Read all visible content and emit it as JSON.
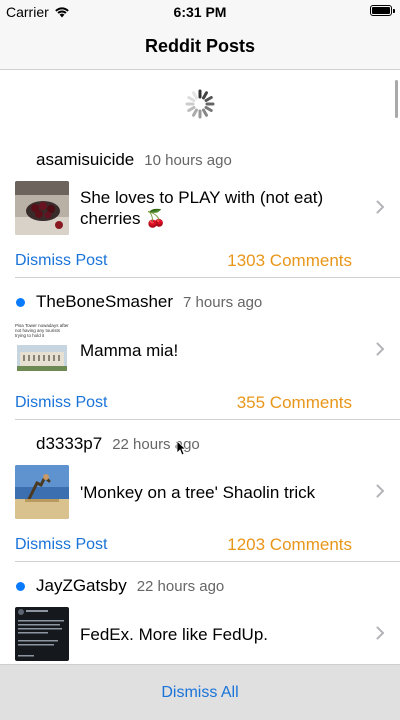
{
  "status_bar": {
    "carrier": "Carrier",
    "time": "6:31 PM"
  },
  "nav": {
    "title": "Reddit Posts"
  },
  "posts": [
    {
      "author": "asamisuicide",
      "time": "10 hours ago",
      "title": "She loves to PLAY with (not eat) cherries 🍒",
      "unread": false,
      "comments": "1303 Comments",
      "dismiss": "Dismiss Post"
    },
    {
      "author": "TheBoneSmasher",
      "time": "7 hours ago",
      "title": "Mamma mia!",
      "unread": true,
      "comments": "355 Comments",
      "dismiss": "Dismiss Post",
      "thumb_caption": "Pisa Tower nowadays after not having any tourists trying to hold it"
    },
    {
      "author": "d3333p7",
      "time": "22 hours ago",
      "title": "'Monkey on a tree' Shaolin trick",
      "unread": false,
      "comments": "1203 Comments",
      "dismiss": "Dismiss Post"
    },
    {
      "author": "JayZGatsby",
      "time": "22 hours ago",
      "title": "FedEx. More like FedUp.",
      "unread": true,
      "comments": "",
      "dismiss": ""
    }
  ],
  "footer": {
    "dismiss_all": "Dismiss All"
  },
  "colors": {
    "link": "#1a73d9",
    "comments": "#e8961a",
    "unread_dot": "#0a7aff"
  }
}
